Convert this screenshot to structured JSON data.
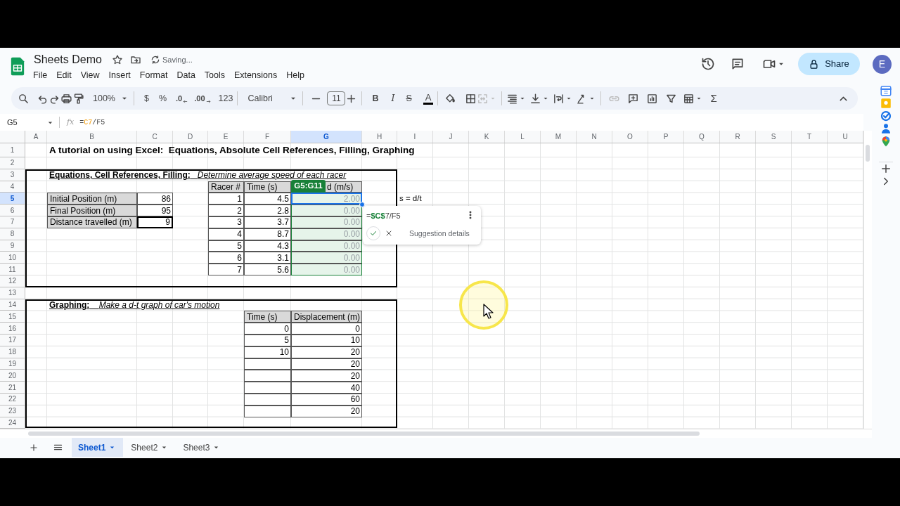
{
  "document": {
    "title": "Sheets Demo",
    "status": "Saving..."
  },
  "menu": [
    "File",
    "Edit",
    "View",
    "Insert",
    "Format",
    "Data",
    "Tools",
    "Extensions",
    "Help"
  ],
  "share": "Share",
  "avatar": "E",
  "toolbar": {
    "zoom": "100%",
    "currency": "$",
    "percent": "%",
    "decrease_decimals": ".0",
    "increase_decimals": ".00",
    "number_format": "123",
    "font": "Calibri",
    "font_size": "11",
    "bold": "B",
    "italic": "I",
    "strikethrough": "S",
    "text_color": "A",
    "sum": "Σ"
  },
  "name_box": "G5",
  "fx": "fx",
  "formula": [
    {
      "text": "=",
      "kind": "plain"
    },
    {
      "text": "C7",
      "kind": "ref"
    },
    {
      "text": "/F5",
      "kind": "plain"
    }
  ],
  "columns": [
    {
      "label": "A",
      "selected": false
    },
    {
      "label": "B",
      "selected": false
    },
    {
      "label": "C",
      "selected": false
    },
    {
      "label": "D",
      "selected": false
    },
    {
      "label": "E",
      "selected": false
    },
    {
      "label": "F",
      "selected": false
    },
    {
      "label": "G",
      "selected": true
    },
    {
      "label": "H",
      "selected": false
    },
    {
      "label": "I",
      "selected": false
    },
    {
      "label": "J",
      "selected": false
    },
    {
      "label": "K",
      "selected": false
    },
    {
      "label": "L",
      "selected": false
    },
    {
      "label": "M",
      "selected": false
    },
    {
      "label": "N",
      "selected": false
    },
    {
      "label": "O",
      "selected": false
    },
    {
      "label": "P",
      "selected": false
    },
    {
      "label": "Q",
      "selected": false
    },
    {
      "label": "R",
      "selected": false
    },
    {
      "label": "S",
      "selected": false
    },
    {
      "label": "T",
      "selected": false
    },
    {
      "label": "U",
      "selected": false
    }
  ],
  "rows": [
    {
      "label": "1",
      "selected": false,
      "cells": [
        {
          "kind": "empty"
        },
        {
          "kind": "title",
          "text": "A tutorial on using Excel:  Equations, Absolute Cell References, Filling, Graphing"
        }
      ]
    },
    {
      "label": "2",
      "selected": false
    },
    {
      "label": "3",
      "selected": false,
      "cells": [
        {
          "kind": "empty"
        },
        {
          "kind": "section",
          "text": "**Equations, Cell References, Filling:**   *Determine average speed of each racer*"
        }
      ]
    },
    {
      "label": "4",
      "selected": false,
      "cells": [
        {
          "kind": "empty"
        },
        {
          "kind": "empty"
        },
        {
          "kind": "empty"
        },
        {
          "kind": "empty"
        },
        {
          "kind": "header",
          "text": "Racer #"
        },
        {
          "kind": "header",
          "text": "Time (s)"
        },
        {
          "kind": "header_partial",
          "text": "d (m/s)"
        }
      ]
    },
    {
      "label": "5",
      "selected": true,
      "cells": [
        {
          "kind": "empty"
        },
        {
          "kind": "label",
          "text": "Initial Position (m)"
        },
        {
          "kind": "value",
          "text": "86"
        },
        {
          "kind": "empty"
        },
        {
          "kind": "value",
          "text": "1"
        },
        {
          "kind": "value",
          "text": "4.5"
        },
        {
          "kind": "computed",
          "text": "2.00"
        },
        {
          "kind": "empty"
        },
        {
          "kind": "plain",
          "text": "s = d/t"
        }
      ]
    },
    {
      "label": "6",
      "selected": false,
      "cells": [
        {
          "kind": "empty"
        },
        {
          "kind": "label",
          "text": "Final Position (m)"
        },
        {
          "kind": "value",
          "text": "95"
        },
        {
          "kind": "empty"
        },
        {
          "kind": "value",
          "text": "2"
        },
        {
          "kind": "value",
          "text": "2.8"
        },
        {
          "kind": "computed",
          "text": "0.00"
        }
      ]
    },
    {
      "label": "7",
      "selected": false,
      "cells": [
        {
          "kind": "empty"
        },
        {
          "kind": "label",
          "text": "Distance travelled (m)"
        },
        {
          "kind": "key_value",
          "text": "9"
        },
        {
          "kind": "empty"
        },
        {
          "kind": "value",
          "text": "3"
        },
        {
          "kind": "value",
          "text": "3.7"
        },
        {
          "kind": "computed",
          "text": "0.00"
        }
      ]
    },
    {
      "label": "8",
      "selected": false,
      "cells": [
        {
          "kind": "empty"
        },
        {
          "kind": "empty"
        },
        {
          "kind": "empty"
        },
        {
          "kind": "empty"
        },
        {
          "kind": "value",
          "text": "4"
        },
        {
          "kind": "value",
          "text": "8.7"
        },
        {
          "kind": "computed",
          "text": "0.00"
        }
      ]
    },
    {
      "label": "9",
      "selected": false,
      "cells": [
        {
          "kind": "empty"
        },
        {
          "kind": "empty"
        },
        {
          "kind": "empty"
        },
        {
          "kind": "empty"
        },
        {
          "kind": "value",
          "text": "5"
        },
        {
          "kind": "value",
          "text": "4.3"
        },
        {
          "kind": "computed",
          "text": "0.00"
        }
      ]
    },
    {
      "label": "10",
      "selected": false,
      "cells": [
        {
          "kind": "empty"
        },
        {
          "kind": "empty"
        },
        {
          "kind": "empty"
        },
        {
          "kind": "empty"
        },
        {
          "kind": "value",
          "text": "6"
        },
        {
          "kind": "value",
          "text": "3.1"
        },
        {
          "kind": "computed",
          "text": "0.00"
        }
      ]
    },
    {
      "label": "11",
      "selected": false,
      "cells": [
        {
          "kind": "empty"
        },
        {
          "kind": "empty"
        },
        {
          "kind": "empty"
        },
        {
          "kind": "empty"
        },
        {
          "kind": "value",
          "text": "7"
        },
        {
          "kind": "value",
          "text": "5.6"
        },
        {
          "kind": "computed",
          "text": "0.00"
        }
      ]
    },
    {
      "label": "12",
      "selected": false
    },
    {
      "label": "13",
      "selected": false
    },
    {
      "label": "14",
      "selected": false,
      "cells": [
        {
          "kind": "empty"
        },
        {
          "kind": "section",
          "text": "**Graphing:**    *Make a d-t graph of car's motion*"
        }
      ]
    },
    {
      "label": "15",
      "selected": false,
      "cells": [
        {
          "kind": "empty"
        },
        {
          "kind": "empty"
        },
        {
          "kind": "empty"
        },
        {
          "kind": "empty"
        },
        {
          "kind": "empty"
        },
        {
          "kind": "header",
          "text": "Time (s)"
        },
        {
          "kind": "header",
          "text": "Displacement (m)"
        }
      ]
    },
    {
      "label": "16",
      "selected": false,
      "cells": [
        {
          "kind": "empty"
        },
        {
          "kind": "empty"
        },
        {
          "kind": "empty"
        },
        {
          "kind": "empty"
        },
        {
          "kind": "empty"
        },
        {
          "kind": "value",
          "text": "0"
        },
        {
          "kind": "value",
          "text": "0"
        }
      ]
    },
    {
      "label": "17",
      "selected": false,
      "cells": [
        {
          "kind": "empty"
        },
        {
          "kind": "empty"
        },
        {
          "kind": "empty"
        },
        {
          "kind": "empty"
        },
        {
          "kind": "empty"
        },
        {
          "kind": "value",
          "text": "5"
        },
        {
          "kind": "value",
          "text": "10"
        }
      ]
    },
    {
      "label": "18",
      "selected": false,
      "cells": [
        {
          "kind": "empty"
        },
        {
          "kind": "empty"
        },
        {
          "kind": "empty"
        },
        {
          "kind": "empty"
        },
        {
          "kind": "empty"
        },
        {
          "kind": "value",
          "text": "10"
        },
        {
          "kind": "value",
          "text": "20"
        }
      ]
    },
    {
      "label": "19",
      "selected": false,
      "cells": [
        {
          "kind": "empty"
        },
        {
          "kind": "empty"
        },
        {
          "kind": "empty"
        },
        {
          "kind": "empty"
        },
        {
          "kind": "empty"
        },
        {
          "kind": "value"
        },
        {
          "kind": "value",
          "text": "20"
        }
      ]
    },
    {
      "label": "20",
      "selected": false,
      "cells": [
        {
          "kind": "empty"
        },
        {
          "kind": "empty"
        },
        {
          "kind": "empty"
        },
        {
          "kind": "empty"
        },
        {
          "kind": "empty"
        },
        {
          "kind": "value"
        },
        {
          "kind": "value",
          "text": "20"
        }
      ]
    },
    {
      "label": "21",
      "selected": false,
      "cells": [
        {
          "kind": "empty"
        },
        {
          "kind": "empty"
        },
        {
          "kind": "empty"
        },
        {
          "kind": "empty"
        },
        {
          "kind": "empty"
        },
        {
          "kind": "value"
        },
        {
          "kind": "value",
          "text": "40"
        }
      ]
    },
    {
      "label": "22",
      "selected": false,
      "cells": [
        {
          "kind": "empty"
        },
        {
          "kind": "empty"
        },
        {
          "kind": "empty"
        },
        {
          "kind": "empty"
        },
        {
          "kind": "empty"
        },
        {
          "kind": "value"
        },
        {
          "kind": "value",
          "text": "60"
        }
      ]
    },
    {
      "label": "23",
      "selected": false,
      "cells": [
        {
          "kind": "empty"
        },
        {
          "kind": "empty"
        },
        {
          "kind": "empty"
        },
        {
          "kind": "empty"
        },
        {
          "kind": "empty"
        },
        {
          "kind": "value"
        },
        {
          "kind": "value",
          "text": "20"
        }
      ]
    },
    {
      "label": "24",
      "selected": false
    }
  ],
  "selection_badge": "G5:G11",
  "suggestion": {
    "formula": [
      {
        "text": "=",
        "kind": "plain"
      },
      {
        "text": "$C$",
        "kind": "ref"
      },
      {
        "text": "7/F5",
        "kind": "plain"
      }
    ],
    "details": "Suggestion details"
  },
  "sheets": [
    {
      "label": "Sheet1",
      "selected": true
    },
    {
      "label": "Sheet2",
      "selected": false
    },
    {
      "label": "Sheet3",
      "selected": false
    }
  ]
}
